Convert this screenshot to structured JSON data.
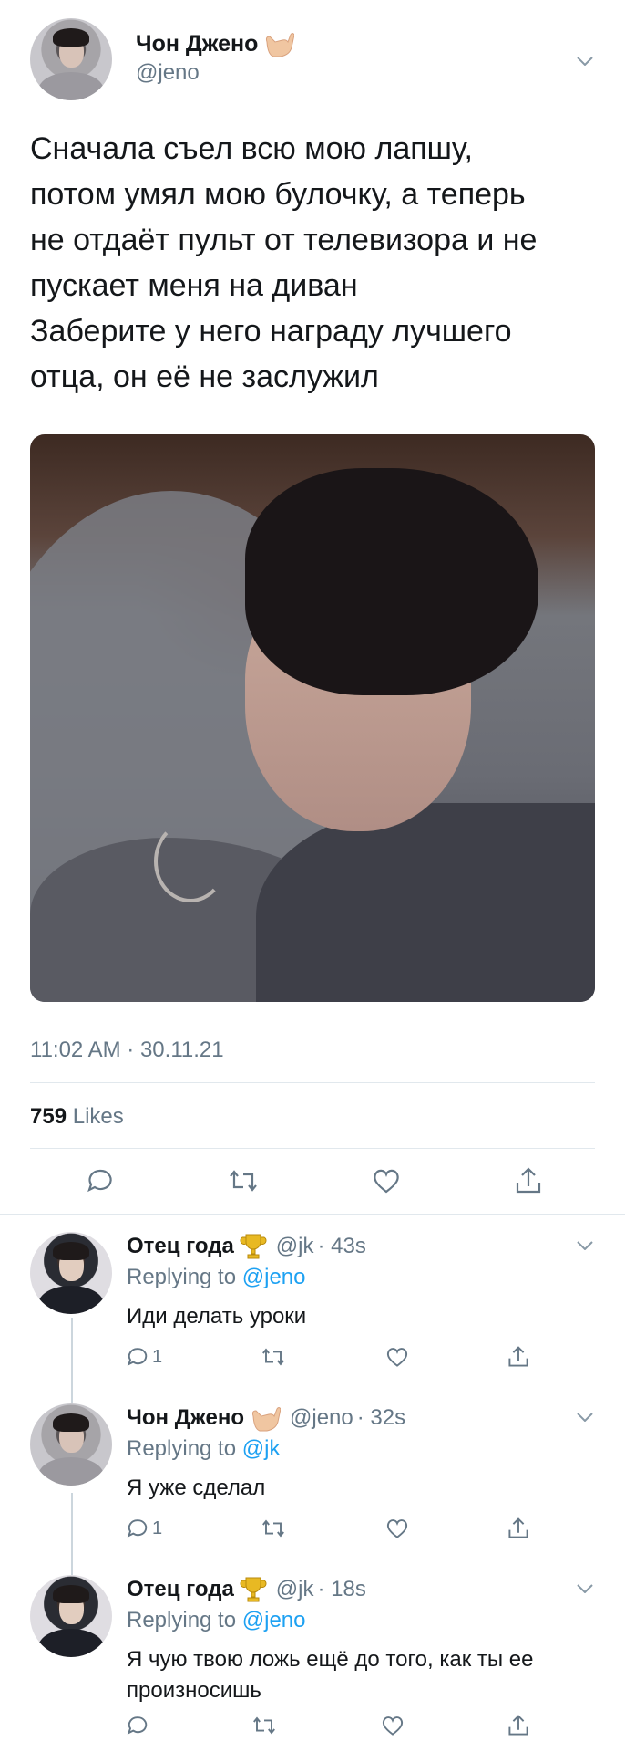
{
  "tweet": {
    "author_name": "Чон Джено",
    "author_handle": "@jeno",
    "text": "Сначала съел всю мою лапшу,\nпотом умял мою булочку, а теперь\nне отдаёт пульт от телевизора и не\nпускает меня на диван\nЗаберите у него награду лучшего\nотца, он её не заслужил",
    "timestamp": "11:02 AM · 30.11.21",
    "likes_count": "759",
    "likes_label": "Likes"
  },
  "replies": [
    {
      "author_name": "Отец года",
      "author_handle": "@jk",
      "time": "· 43s",
      "replying_label": "Replying to",
      "replying_mention": "@jeno",
      "text": "Иди делать уроки",
      "reply_count": "1",
      "badge": "trophy-icon"
    },
    {
      "author_name": "Чон Джено",
      "author_handle": "@jeno",
      "time": "· 32s",
      "replying_label": "Replying to",
      "replying_mention": "@jk",
      "text": "Я уже сделал",
      "reply_count": "1",
      "badge": "call-me-hand-icon"
    },
    {
      "author_name": "Отец года",
      "author_handle": "@jk",
      "time": "· 18s",
      "replying_label": "Replying to",
      "replying_mention": "@jeno",
      "text": "Я чую твою ложь ещё до того, как ты ее произносишь",
      "reply_count": "",
      "badge": "trophy-icon"
    }
  ],
  "colors": {
    "text": "#14171a",
    "secondary": "#657786",
    "link": "#1da1f2",
    "divider": "#e1e8ed"
  }
}
